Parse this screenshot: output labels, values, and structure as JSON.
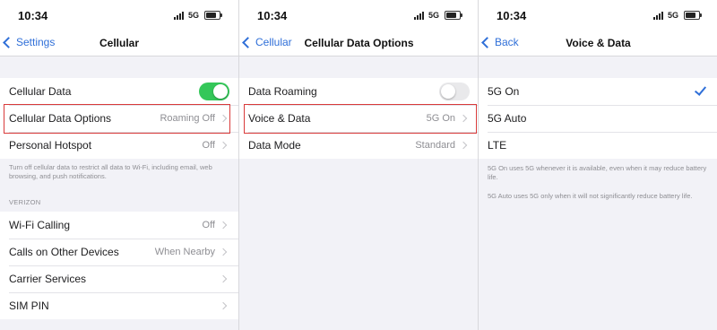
{
  "status": {
    "time": "10:34",
    "network": "5G"
  },
  "screen1": {
    "back_label": "Settings",
    "title": "Cellular",
    "rows": [
      {
        "label": "Cellular Data",
        "toggle": "on"
      },
      {
        "label": "Cellular Data Options",
        "value": "Roaming Off"
      },
      {
        "label": "Personal Hotspot",
        "value": "Off"
      }
    ],
    "footnote": "Turn off cellular data to restrict all data to Wi-Fi, including email, web browsing, and push notifications.",
    "section_header": "VERIZON",
    "carrier_rows": [
      {
        "label": "Wi-Fi Calling",
        "value": "Off"
      },
      {
        "label": "Calls on Other Devices",
        "value": "When Nearby"
      },
      {
        "label": "Carrier Services",
        "value": ""
      },
      {
        "label": "SIM PIN",
        "value": ""
      }
    ]
  },
  "screen2": {
    "back_label": "Cellular",
    "title": "Cellular Data Options",
    "rows": [
      {
        "label": "Data Roaming",
        "toggle": "off"
      },
      {
        "label": "Voice & Data",
        "value": "5G On"
      },
      {
        "label": "Data Mode",
        "value": "Standard"
      }
    ]
  },
  "screen3": {
    "back_label": "Back",
    "title": "Voice & Data",
    "options": [
      {
        "label": "5G On",
        "selected": true
      },
      {
        "label": "5G Auto",
        "selected": false
      },
      {
        "label": "LTE",
        "selected": false
      }
    ],
    "footnote1": "5G On uses 5G whenever it is available, even when it may reduce battery life.",
    "footnote2": "5G Auto uses 5G only when it will not significantly reduce battery life."
  },
  "colors": {
    "accent": "#2f6fd8",
    "toggle_on": "#34c759",
    "highlight": "#d93a3a"
  }
}
